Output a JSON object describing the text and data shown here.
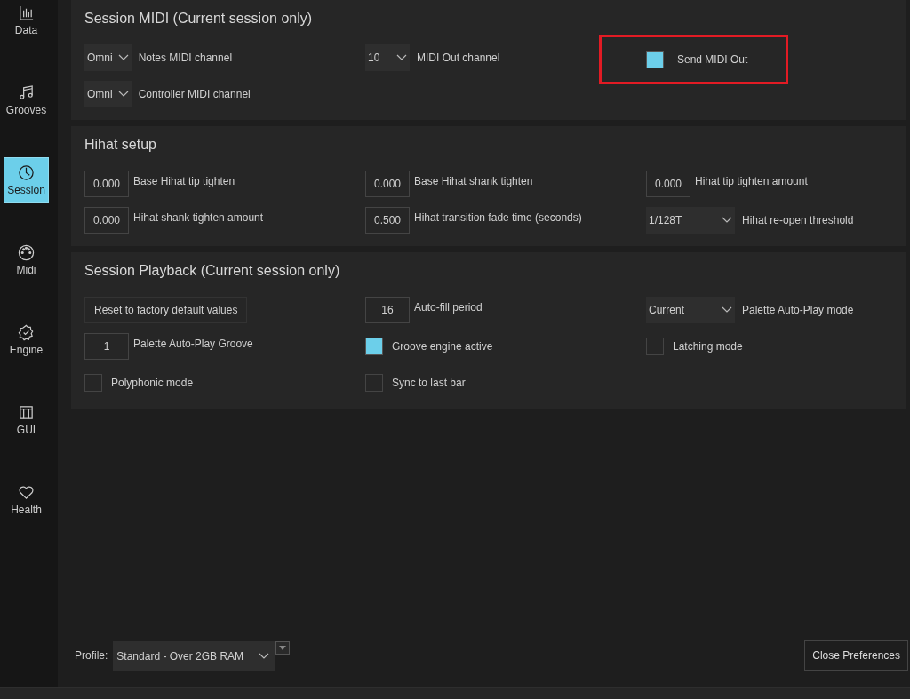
{
  "sidebar": {
    "items": [
      {
        "label": "Data",
        "selected": false
      },
      {
        "label": "Grooves",
        "selected": false
      },
      {
        "label": "Session",
        "selected": true
      },
      {
        "label": "Midi",
        "selected": false
      },
      {
        "label": "Engine",
        "selected": false
      },
      {
        "label": "GUI",
        "selected": false
      },
      {
        "label": "Health",
        "selected": false
      }
    ]
  },
  "panels": [
    {
      "title": "Session MIDI (Current session only)",
      "rows": [
        [
          {
            "kind": "dropdown",
            "selection": "Omni",
            "label": "Notes MIDI channel",
            "highlighted": false
          },
          {
            "kind": "dropdown",
            "selection": "10",
            "label": "MIDI Out channel",
            "highlighted": false
          },
          {
            "kind": "checkbox",
            "checked": true,
            "label": "Send MIDI Out",
            "highlighted": true
          }
        ],
        [
          {
            "kind": "dropdown",
            "selection": "Omni",
            "label": "Controller MIDI channel",
            "highlighted": false
          }
        ]
      ]
    },
    {
      "title": "Hihat setup",
      "rows": [
        [
          {
            "kind": "number",
            "value": "0.000",
            "label": "Base Hihat tip tighten",
            "highlighted": false
          },
          {
            "kind": "number",
            "value": "0.000",
            "label": "Base Hihat shank tighten",
            "highlighted": false
          },
          {
            "kind": "number",
            "value": "0.000",
            "label": "Hihat tip tighten amount",
            "highlighted": false
          }
        ],
        [
          {
            "kind": "number",
            "value": "0.000",
            "label": "Hihat shank tighten amount",
            "highlighted": false
          },
          {
            "kind": "number",
            "value": "0.500",
            "label": "Hihat transition fade time (seconds)",
            "highlighted": false
          },
          {
            "kind": "dropdown",
            "selection": "1/128T",
            "label": "Hihat re-open threshold",
            "highlighted": false
          }
        ]
      ]
    },
    {
      "title": "Session Playback (Current session only)",
      "rows": [
        [
          {
            "kind": "button",
            "label": "Reset to factory default values",
            "highlighted": false
          },
          {
            "kind": "number",
            "value": "16",
            "label": "Auto-fill period",
            "highlighted": false
          },
          {
            "kind": "dropdown",
            "selection": "Current",
            "label": "Palette Auto-Play mode",
            "highlighted": false
          }
        ],
        [
          {
            "kind": "number",
            "value": "1",
            "label": "Palette Auto-Play Groove",
            "highlighted": false
          },
          {
            "kind": "checkbox",
            "checked": true,
            "label": "Groove engine active",
            "highlighted": false
          },
          {
            "kind": "checkbox",
            "checked": false,
            "label": "Latching mode",
            "highlighted": false
          }
        ],
        [
          {
            "kind": "checkbox",
            "checked": false,
            "label": "Polyphonic mode",
            "highlighted": false
          },
          {
            "kind": "checkbox",
            "checked": false,
            "label": "Sync to last bar",
            "highlighted": false
          }
        ]
      ]
    }
  ],
  "footer": {
    "profile_label": "Profile:",
    "profile_value": "Standard - Over 2GB RAM",
    "close_button": "Close Preferences"
  }
}
